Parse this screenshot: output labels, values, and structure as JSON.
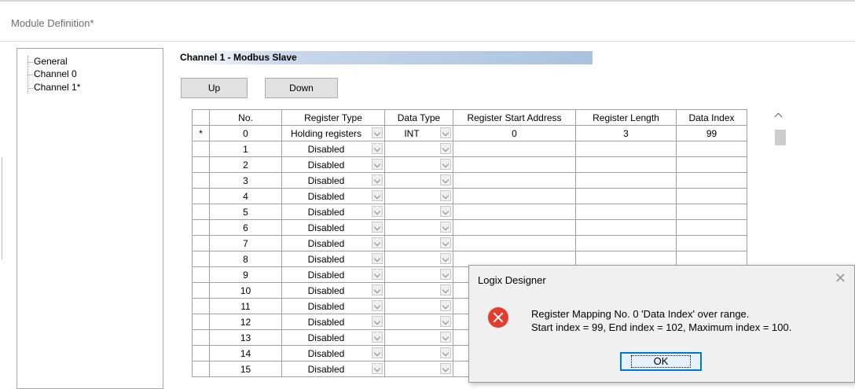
{
  "window": {
    "title": "Module Definition*"
  },
  "tree": {
    "items": [
      {
        "label": "General"
      },
      {
        "label": "Channel 0"
      },
      {
        "label": "Channel 1*"
      }
    ]
  },
  "channel": {
    "title": "Channel 1 - Modbus Slave"
  },
  "buttons": {
    "up": "Up",
    "down": "Down"
  },
  "table": {
    "columns": [
      "No.",
      "Register Type",
      "Data Type",
      "Register Start Address",
      "Register Length",
      "Data Index"
    ],
    "rows": [
      {
        "marker": "*",
        "no": "0",
        "register_type": "Holding registers",
        "data_type": "INT",
        "start": "0",
        "length": "3",
        "index": "99"
      },
      {
        "marker": "",
        "no": "1",
        "register_type": "Disabled",
        "data_type": "",
        "start": "",
        "length": "",
        "index": ""
      },
      {
        "marker": "",
        "no": "2",
        "register_type": "Disabled",
        "data_type": "",
        "start": "",
        "length": "",
        "index": ""
      },
      {
        "marker": "",
        "no": "3",
        "register_type": "Disabled",
        "data_type": "",
        "start": "",
        "length": "",
        "index": ""
      },
      {
        "marker": "",
        "no": "4",
        "register_type": "Disabled",
        "data_type": "",
        "start": "",
        "length": "",
        "index": ""
      },
      {
        "marker": "",
        "no": "5",
        "register_type": "Disabled",
        "data_type": "",
        "start": "",
        "length": "",
        "index": ""
      },
      {
        "marker": "",
        "no": "6",
        "register_type": "Disabled",
        "data_type": "",
        "start": "",
        "length": "",
        "index": ""
      },
      {
        "marker": "",
        "no": "7",
        "register_type": "Disabled",
        "data_type": "",
        "start": "",
        "length": "",
        "index": ""
      },
      {
        "marker": "",
        "no": "8",
        "register_type": "Disabled",
        "data_type": "",
        "start": "",
        "length": "",
        "index": ""
      },
      {
        "marker": "",
        "no": "9",
        "register_type": "Disabled",
        "data_type": "",
        "start": "",
        "length": "",
        "index": ""
      },
      {
        "marker": "",
        "no": "10",
        "register_type": "Disabled",
        "data_type": "",
        "start": "",
        "length": "",
        "index": ""
      },
      {
        "marker": "",
        "no": "11",
        "register_type": "Disabled",
        "data_type": "",
        "start": "",
        "length": "",
        "index": ""
      },
      {
        "marker": "",
        "no": "12",
        "register_type": "Disabled",
        "data_type": "",
        "start": "",
        "length": "",
        "index": ""
      },
      {
        "marker": "",
        "no": "13",
        "register_type": "Disabled",
        "data_type": "",
        "start": "",
        "length": "",
        "index": ""
      },
      {
        "marker": "",
        "no": "14",
        "register_type": "Disabled",
        "data_type": "",
        "start": "",
        "length": "",
        "index": ""
      },
      {
        "marker": "",
        "no": "15",
        "register_type": "Disabled",
        "data_type": "",
        "start": "",
        "length": "",
        "index": ""
      }
    ]
  },
  "dialog": {
    "title": "Logix Designer",
    "close": "✕",
    "line1": "Register Mapping No. 0 'Data Index' over range.",
    "line2": "Start index = 99, End index = 102, Maximum index = 100.",
    "ok": "OK"
  },
  "icons": {
    "error": "error-icon",
    "close": "close-icon",
    "dropdown": "chevron-down-icon",
    "scroll_up": "scroll-up-icon"
  },
  "colors": {
    "error": "#e53c2e",
    "focus": "#0078d7",
    "header_band": "#aac2e0"
  }
}
